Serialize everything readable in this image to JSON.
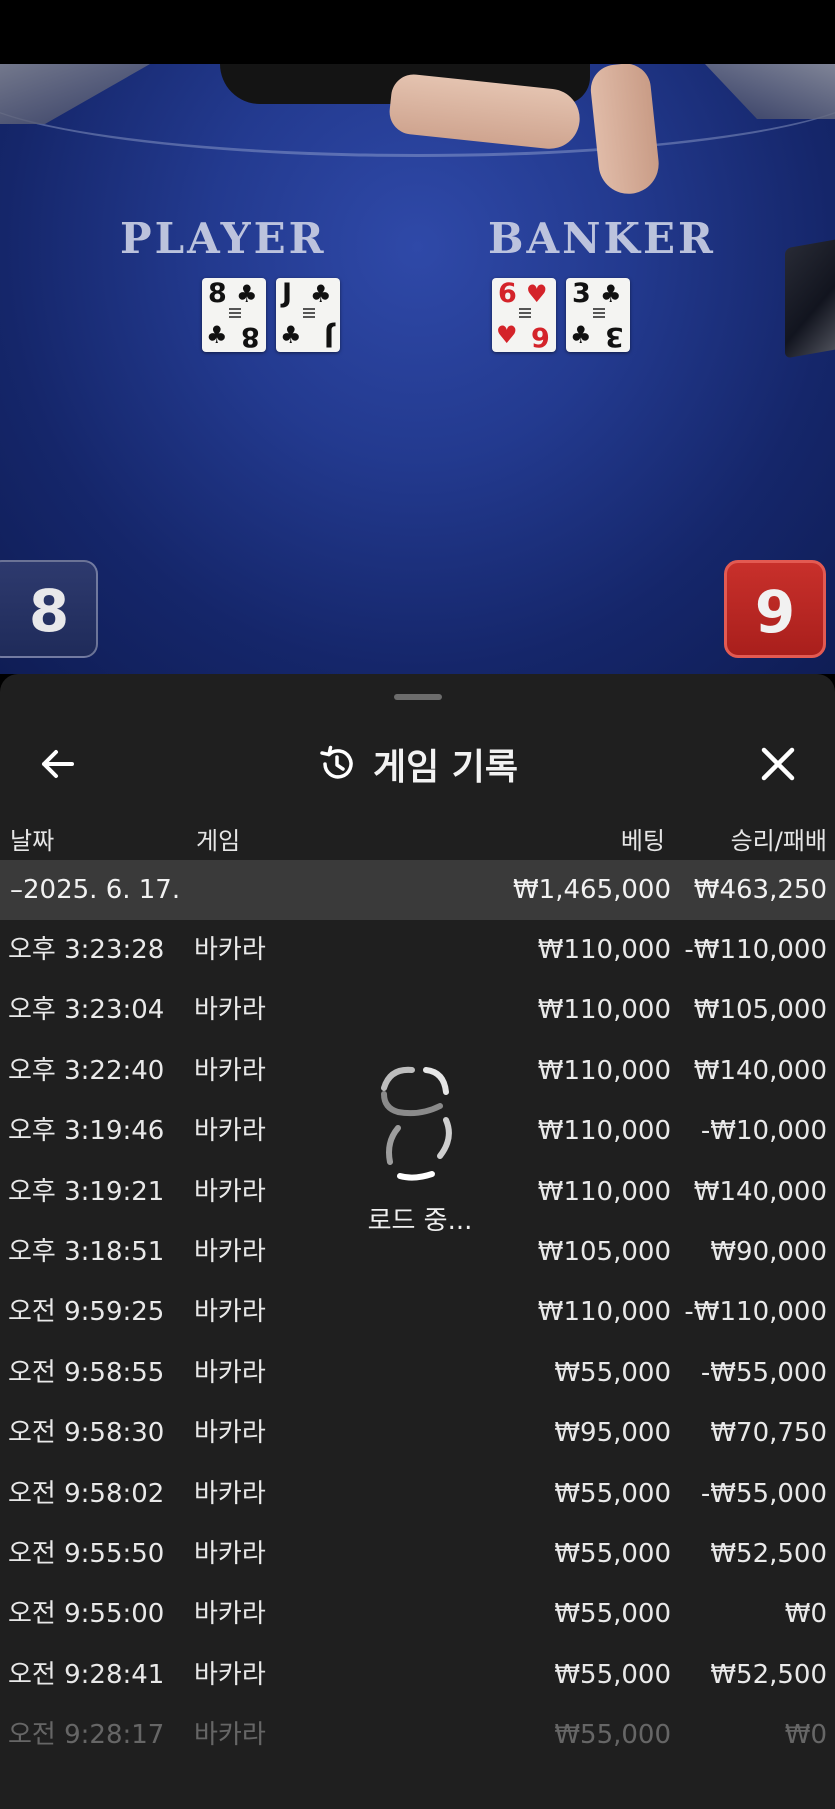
{
  "video": {
    "player_label": "PLAYER",
    "banker_label": "BANKER",
    "player_cards": [
      {
        "rank": "8",
        "suit": "♣",
        "color": "black"
      },
      {
        "rank": "J",
        "suit": "♣",
        "color": "black"
      }
    ],
    "banker_cards": [
      {
        "rank": "6",
        "suit": "♥",
        "color": "red"
      },
      {
        "rank": "3",
        "suit": "♣",
        "color": "black"
      }
    ],
    "player_score": "8",
    "banker_score": "9"
  },
  "history": {
    "title": "게임 기록",
    "icons": {
      "back": "arrow-left-icon",
      "title": "history-icon",
      "close": "close-icon"
    },
    "columns": {
      "date": "날짜",
      "game": "게임",
      "bet": "베팅",
      "win_loss": "승리/패배"
    },
    "group": {
      "date": "–2025. 6. 17.",
      "bet": "₩1,465,000",
      "win_loss": "₩463,250"
    },
    "rows": [
      {
        "time": "오후 3:23:28",
        "game": "바카라",
        "bet": "₩110,000",
        "win_loss": "-₩110,000"
      },
      {
        "time": "오후 3:23:04",
        "game": "바카라",
        "bet": "₩110,000",
        "win_loss": "₩105,000"
      },
      {
        "time": "오후 3:22:40",
        "game": "바카라",
        "bet": "₩110,000",
        "win_loss": "₩140,000"
      },
      {
        "time": "오후 3:19:46",
        "game": "바카라",
        "bet": "₩110,000",
        "win_loss": "-₩10,000"
      },
      {
        "time": "오후 3:19:21",
        "game": "바카라",
        "bet": "₩110,000",
        "win_loss": "₩140,000"
      },
      {
        "time": "오후 3:18:51",
        "game": "바카라",
        "bet": "₩105,000",
        "win_loss": "₩90,000"
      },
      {
        "time": "오전 9:59:25",
        "game": "바카라",
        "bet": "₩110,000",
        "win_loss": "-₩110,000"
      },
      {
        "time": "오전 9:58:55",
        "game": "바카라",
        "bet": "₩55,000",
        "win_loss": "-₩55,000"
      },
      {
        "time": "오전 9:58:30",
        "game": "바카라",
        "bet": "₩95,000",
        "win_loss": "₩70,750"
      },
      {
        "time": "오전 9:58:02",
        "game": "바카라",
        "bet": "₩55,000",
        "win_loss": "-₩55,000"
      },
      {
        "time": "오전 9:55:50",
        "game": "바카라",
        "bet": "₩55,000",
        "win_loss": "₩52,500"
      },
      {
        "time": "오전 9:55:00",
        "game": "바카라",
        "bet": "₩55,000",
        "win_loss": "₩0"
      },
      {
        "time": "오전 9:28:41",
        "game": "바카라",
        "bet": "₩55,000",
        "win_loss": "₩52,500"
      },
      {
        "time": "오전 9:28:17",
        "game": "바카라",
        "bet": "₩55,000",
        "win_loss": "₩0"
      }
    ],
    "loading_text": "로드 중..."
  }
}
